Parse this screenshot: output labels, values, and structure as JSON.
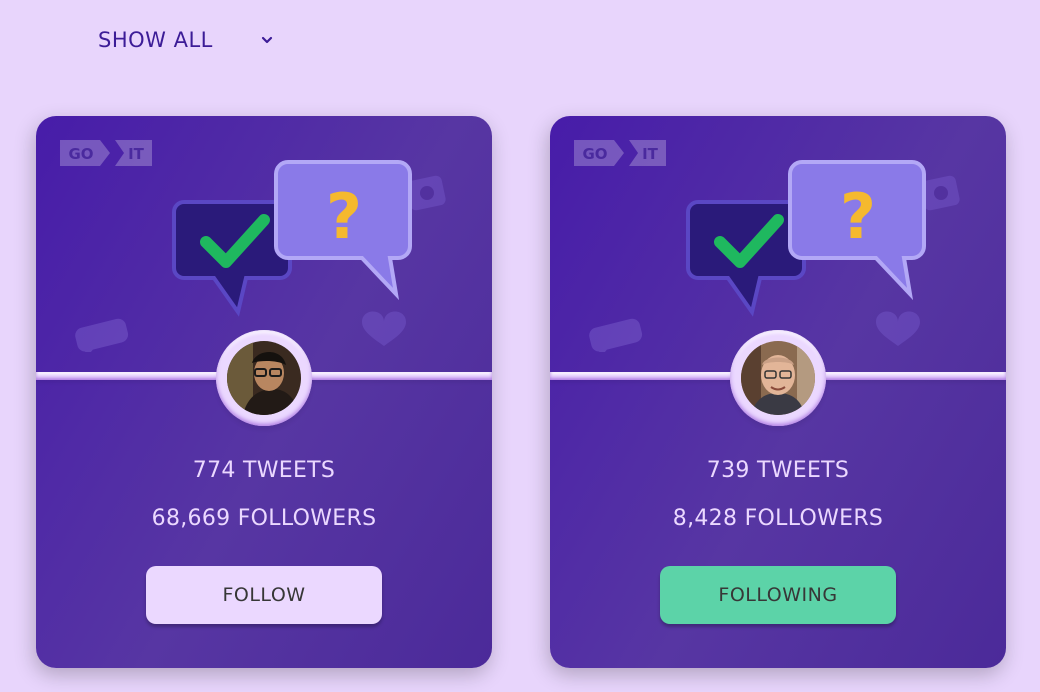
{
  "filter": {
    "label": "SHOW ALL",
    "icon": "chevron-down-icon"
  },
  "logo": {
    "left": "GO",
    "right": "IT"
  },
  "colors": {
    "background": "#e8d5fc",
    "card": "#5736a3",
    "accent_text": "#3c1c97",
    "follow_button": "#ebd8ff",
    "following_button": "#5cd3a8"
  },
  "cards": [
    {
      "tweets": "774 TWEETS",
      "followers": "68,669 FOLLOWERS",
      "button": "FOLLOW",
      "following": false
    },
    {
      "tweets": "739 TWEETS",
      "followers": "8,428 FOLLOWERS",
      "button": "FOLLOWING",
      "following": true
    }
  ]
}
